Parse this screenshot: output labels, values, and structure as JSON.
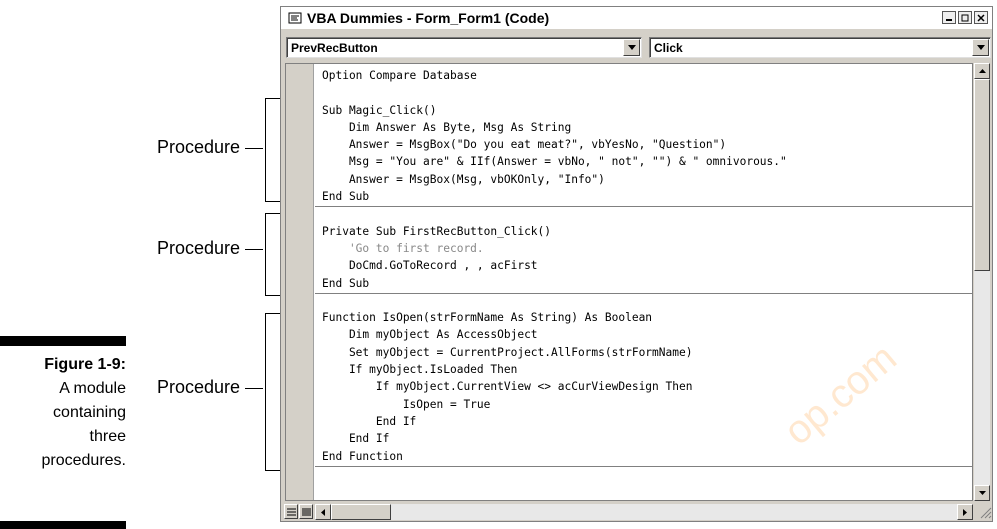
{
  "caption": {
    "title": "Figure 1-9:",
    "lines": [
      "A module",
      "containing",
      "three",
      "procedures."
    ]
  },
  "callouts": [
    {
      "label": "Procedure"
    },
    {
      "label": "Procedure"
    },
    {
      "label": "Procedure"
    }
  ],
  "window": {
    "title": "VBA Dummies - Form_Form1 (Code)",
    "object_combo": "PrevRecButton",
    "procedure_combo": "Click"
  },
  "code": {
    "header": "Option Compare Database",
    "procedures": [
      {
        "lines": [
          {
            "text": "Sub Magic_Click()",
            "comment": false
          },
          {
            "text": "    Dim Answer As Byte, Msg As String",
            "comment": false
          },
          {
            "text": "    Answer = MsgBox(\"Do you eat meat?\", vbYesNo, \"Question\")",
            "comment": false
          },
          {
            "text": "    Msg = \"You are\" & IIf(Answer = vbNo, \" not\", \"\") & \" omnivorous.\"",
            "comment": false
          },
          {
            "text": "    Answer = MsgBox(Msg, vbOKOnly, \"Info\")",
            "comment": false
          },
          {
            "text": "End Sub",
            "comment": false
          }
        ]
      },
      {
        "lines": [
          {
            "text": "Private Sub FirstRecButton_Click()",
            "comment": false
          },
          {
            "text": "    'Go to first record.",
            "comment": true
          },
          {
            "text": "    DoCmd.GoToRecord , , acFirst",
            "comment": false
          },
          {
            "text": "End Sub",
            "comment": false
          }
        ]
      },
      {
        "lines": [
          {
            "text": "Function IsOpen(strFormName As String) As Boolean",
            "comment": false
          },
          {
            "text": "    Dim myObject As AccessObject",
            "comment": false
          },
          {
            "text": "    Set myObject = CurrentProject.AllForms(strFormName)",
            "comment": false
          },
          {
            "text": "    If myObject.IsLoaded Then",
            "comment": false
          },
          {
            "text": "        If myObject.CurrentView <> acCurViewDesign Then",
            "comment": false
          },
          {
            "text": "            IsOpen = True",
            "comment": false
          },
          {
            "text": "        End If",
            "comment": false
          },
          {
            "text": "    End If",
            "comment": false
          },
          {
            "text": "End Function",
            "comment": false
          }
        ]
      }
    ]
  },
  "watermark": "op.com"
}
